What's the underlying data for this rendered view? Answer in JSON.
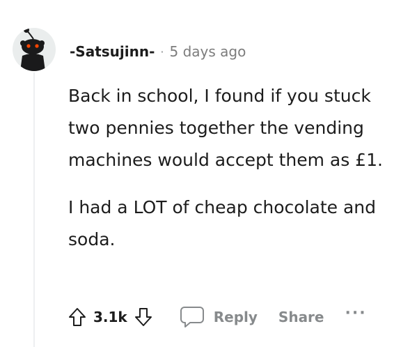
{
  "comment": {
    "author": "-Satsujinn-",
    "separator": "·",
    "timestamp": "5 days ago",
    "paragraphs": [
      "Back in school, I found if you stuck two pennies together the vending machines would accept them as £1.",
      "I had a LOT of cheap chocolate and soda."
    ]
  },
  "actions": {
    "upvote_icon": "arrow-up-icon",
    "score": "3.1k",
    "downvote_icon": "arrow-down-icon",
    "reply_icon": "speech-bubble-icon",
    "reply_label": "Reply",
    "share_label": "Share",
    "more_label": "···"
  },
  "colors": {
    "avatar_bg": "#eaeded",
    "avatar_eyes": "#ff4500",
    "muted_text": "#878a8c",
    "primary_text": "#1c1c1c"
  }
}
